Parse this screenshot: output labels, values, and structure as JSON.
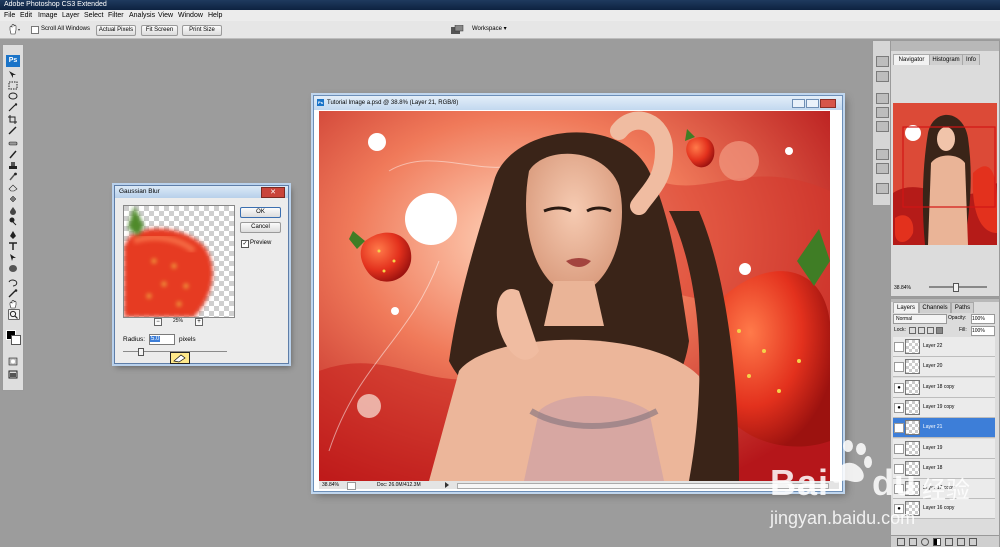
{
  "window": {
    "title": "Adobe Photoshop CS3 Extended"
  },
  "menu": [
    "File",
    "Edit",
    "Image",
    "Layer",
    "Select",
    "Filter",
    "Analysis",
    "View",
    "Window",
    "Help"
  ],
  "options_bar": {
    "scroll_all_windows_label": "Scroll All Windows",
    "scroll_all_windows_checked": false,
    "actual_pixels_label": "Actual Pixels",
    "fit_screen_label": "Fit Screen",
    "print_size_label": "Print Size",
    "workspace_label": "Workspace ▾"
  },
  "tools": {
    "ps_logo": "Ps"
  },
  "dialog": {
    "title": "Gaussian Blur",
    "ok_label": "OK",
    "cancel_label": "Cancel",
    "preview_label": "Preview",
    "preview_checked": true,
    "zoom_minus": "−",
    "zoom_plus": "+",
    "zoom_level": "25%",
    "radius_label": "Radius:",
    "radius_value": "5.0",
    "radius_unit": "pixels"
  },
  "document": {
    "title": "Tutorial Image a.psd @ 38.8% (Layer 21, RGB/8)",
    "status_zoom": "38.84%",
    "status_doc": "Doc: 26.0M/412.3M"
  },
  "navigator": {
    "tabs": [
      "Navigator",
      "Histogram",
      "Info"
    ],
    "active_tab": "Navigator",
    "zoom": "38.84%"
  },
  "layers": {
    "tabs": [
      "Layers",
      "Channels",
      "Paths"
    ],
    "active_tab": "Layers",
    "blend_mode": "Normal",
    "opacity_label": "Opacity:",
    "opacity_value": "100%",
    "lock_label": "Lock:",
    "fill_label": "Fill:",
    "fill_value": "100%",
    "rows": [
      {
        "name": "Layer 22",
        "visible": false,
        "selected": false
      },
      {
        "name": "Layer 20",
        "visible": false,
        "selected": false
      },
      {
        "name": "Layer 18 copy",
        "visible": true,
        "selected": false
      },
      {
        "name": "Layer 19 copy",
        "visible": true,
        "selected": false
      },
      {
        "name": "Layer 21",
        "visible": true,
        "selected": true
      },
      {
        "name": "Layer 19",
        "visible": false,
        "selected": false
      },
      {
        "name": "Layer 18",
        "visible": false,
        "selected": false
      },
      {
        "name": "Layer 17 copy",
        "visible": false,
        "selected": false
      },
      {
        "name": "Layer 16 copy",
        "visible": true,
        "selected": false
      }
    ]
  },
  "watermark": {
    "brand": "Bai",
    "brand2": "du",
    "cn": "经验",
    "url": "jingyan.baidu.com"
  },
  "colors": {
    "selection": "#3d7ed8",
    "canvas_red": "#d8332a",
    "chrome": "#dedede"
  }
}
